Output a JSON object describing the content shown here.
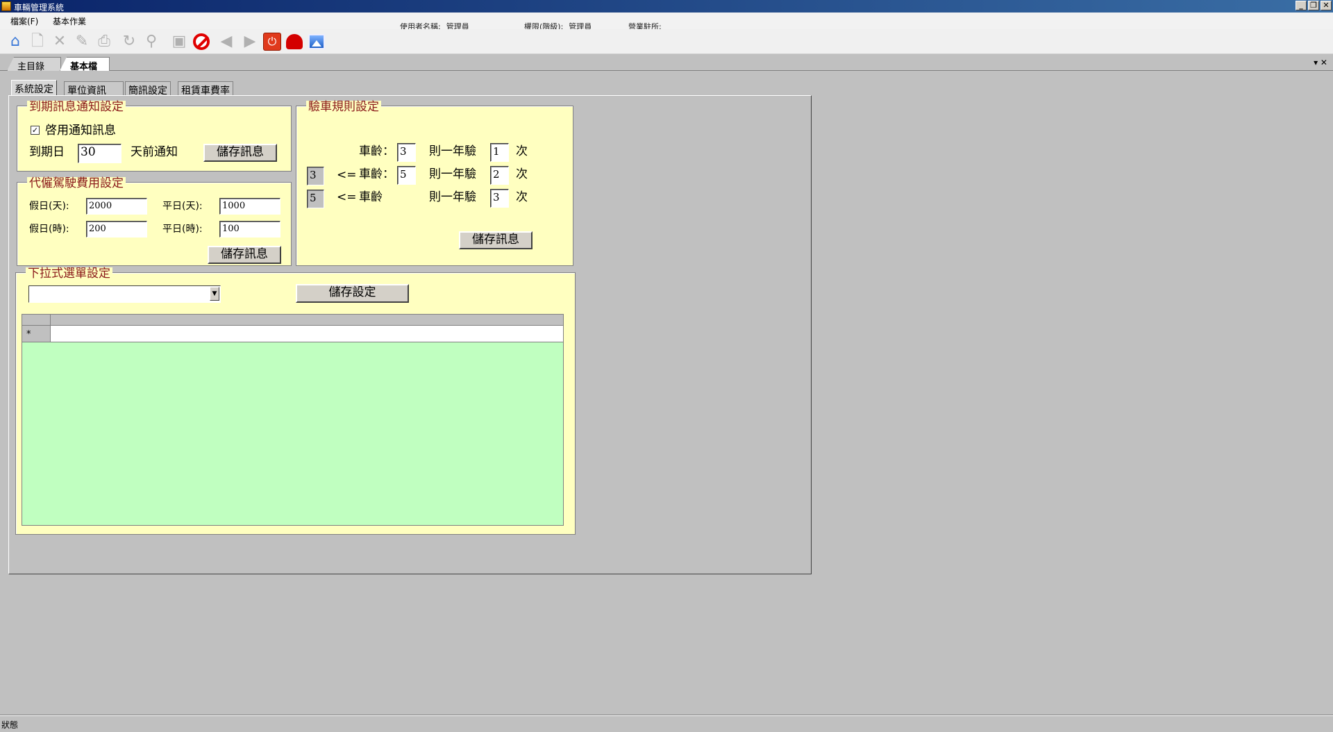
{
  "window": {
    "title": "車輛管理系統",
    "minimize": "_",
    "restore": "❐",
    "close": "✕"
  },
  "menu": {
    "file": "檔案(F)",
    "basic": "基本作業"
  },
  "header_info": {
    "user_label": "使用者名稱:",
    "user_value": "管理員",
    "role_label": "權限(階級):",
    "role_value": "管理員",
    "office_label": "營業駐所:",
    "office_value": ""
  },
  "toolbar": {
    "icons": [
      "home-icon",
      "new-icon",
      "delete-icon",
      "edit-icon",
      "print-icon",
      "refresh-icon",
      "search-icon",
      "save-icon",
      "cancel-icon",
      "prev-icon",
      "next-icon",
      "power-icon",
      "alarm-icon",
      "image-icon"
    ]
  },
  "doc_tabs": [
    {
      "label": "主目錄"
    },
    {
      "label": "基本檔",
      "active": true
    }
  ],
  "doc_controls": "▾ ✕",
  "tabs": [
    {
      "label": "系統設定",
      "active": true
    },
    {
      "label": "單位資訊"
    },
    {
      "label": "簡訊設定"
    },
    {
      "label": "租賃車費率"
    }
  ],
  "expiry": {
    "legend": "到期訊息通知設定",
    "enable_label": "啓用通知訊息",
    "enabled": true,
    "check_mark": "✓",
    "due_label": "到期日",
    "days_value": "30",
    "days_suffix": "天前通知",
    "save_label": "儲存訊息"
  },
  "driver_fee": {
    "legend": "代僱駕駛費用設定",
    "holiday_day_label": "假日(天):",
    "holiday_day_value": "2000",
    "weekday_day_label": "平日(天):",
    "weekday_day_value": "1000",
    "holiday_hour_label": "假日(時):",
    "holiday_hour_value": "200",
    "weekday_hour_label": "平日(時):",
    "weekday_hour_value": "100",
    "save_label": "儲存訊息"
  },
  "inspection": {
    "legend": "驗車規則設定",
    "rows": [
      {
        "low": "",
        "op": "",
        "age_label": "車齡：",
        "age_value": "3",
        "rule_label": "則一年驗",
        "times": "1",
        "unit": "次"
      },
      {
        "low": "3",
        "op": "<=",
        "age_label": "車齡：",
        "age_value": "5",
        "rule_label": "則一年驗",
        "times": "2",
        "unit": "次"
      },
      {
        "low": "5",
        "op": "<=",
        "age_label": "車齡",
        "age_value": "",
        "rule_label": "則一年驗",
        "times": "3",
        "unit": "次"
      }
    ],
    "save_label": "儲存訊息"
  },
  "dropdown": {
    "legend": "下拉式選單設定",
    "selected": "",
    "arrow": "▼",
    "save_label": "儲存設定",
    "grid": {
      "new_row_marker": "*"
    }
  },
  "status": {
    "text": "狀態"
  }
}
